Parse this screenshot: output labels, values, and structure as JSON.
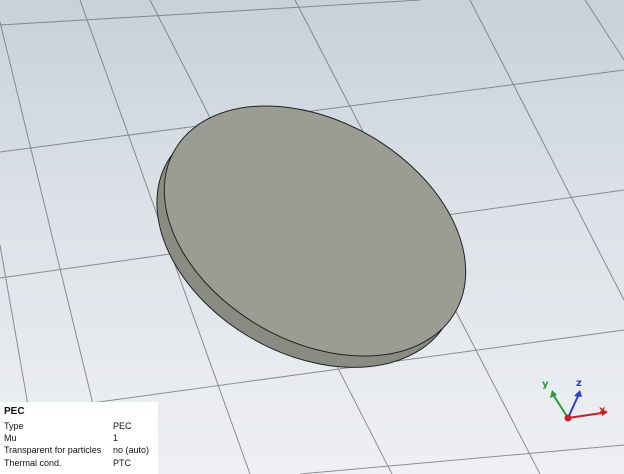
{
  "material_panel": {
    "title": "PEC",
    "rows": [
      {
        "key": "Type",
        "value": "PEC"
      },
      {
        "key": "Mu",
        "value": "1"
      },
      {
        "key": "Transparent for particles",
        "value": "no (auto)"
      },
      {
        "key": "Thermal cond.",
        "value": "PTC"
      }
    ]
  },
  "axes": {
    "x_label": "x",
    "y_label": "y",
    "z_label": "z",
    "x_color": "#c0222a",
    "y_color": "#2a9a3a",
    "z_color": "#2a3fd0"
  },
  "scene": {
    "background_top": "#c9d0da",
    "background_bottom": "#eef0f3",
    "grid_color": "#6a6f75",
    "disk_face_color": "#9b9c92",
    "disk_edge_color": "#888a80",
    "object": "disk"
  }
}
